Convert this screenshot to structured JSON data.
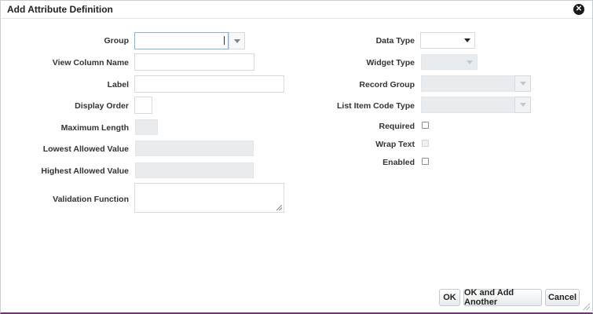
{
  "dialog": {
    "title": "Add Attribute Definition",
    "close_icon": "close-circle-icon"
  },
  "left_form": {
    "group_label": "Group",
    "group_value": "",
    "view_column_name_label": "View Column Name",
    "label_label": "Label",
    "display_order_label": "Display Order",
    "maximum_length_label": "Maximum Length",
    "lowest_allowed_value_label": "Lowest Allowed Value",
    "highest_allowed_value_label": "Highest Allowed Value",
    "validation_function_label": "Validation Function"
  },
  "right_form": {
    "data_type_label": "Data Type",
    "data_type_value": "",
    "widget_type_label": "Widget Type",
    "record_group_label": "Record Group",
    "list_item_code_type_label": "List Item Code Type",
    "required_label": "Required",
    "required_checked": false,
    "wrap_text_label": "Wrap Text",
    "wrap_text_checked": false,
    "enabled_label": "Enabled",
    "enabled_checked": false
  },
  "buttons": {
    "ok": "OK",
    "ok_add_another": "OK and Add Another",
    "cancel": "Cancel"
  },
  "colors": {
    "accent_bottom_border": "#6b3a6f",
    "focus_border": "#7fb2e5",
    "disabled_field": "#e8ecee"
  }
}
